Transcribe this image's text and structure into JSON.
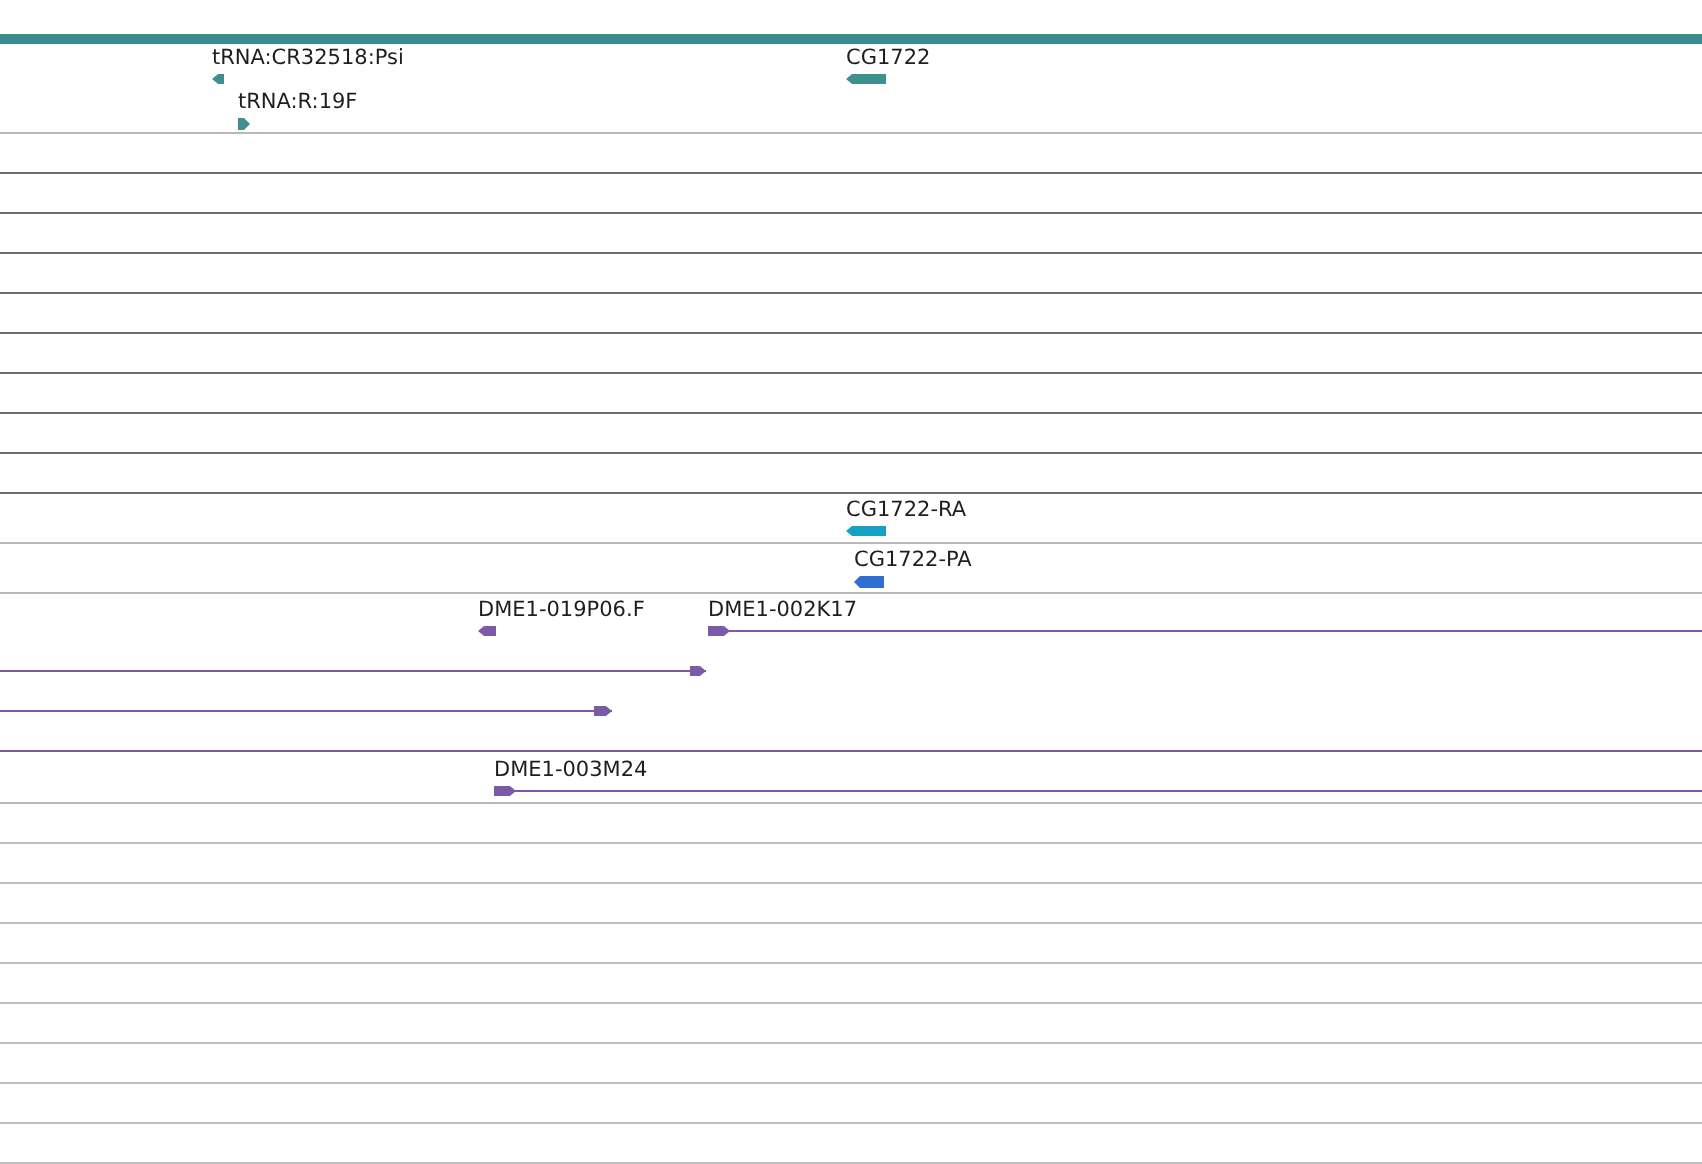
{
  "tracks": [
    {
      "kind": "gene",
      "lanes": [
        {
          "features": [
            {
              "kind": "arrow",
              "label": "tRNA:CR32518:Psi",
              "reverse": true,
              "color": "#3f8f91"
            },
            {
              "kind": "arrow",
              "label": "CG1722",
              "reverse": true,
              "color": "#3f8f91"
            }
          ]
        },
        {
          "features": [
            {
              "kind": "arrow",
              "label": "tRNA:R:19F",
              "reverse": false,
              "color": "#3f8f91"
            }
          ]
        }
      ]
    },
    {
      "kind": "spacer"
    },
    {
      "kind": "spacer"
    },
    {
      "kind": "spacer"
    },
    {
      "kind": "spacer"
    },
    {
      "kind": "spacer"
    },
    {
      "kind": "spacer"
    },
    {
      "kind": "spacer"
    },
    {
      "kind": "spacer"
    },
    {
      "kind": "spacer"
    },
    {
      "kind": "transcript",
      "lanes": [
        {
          "features": [
            {
              "kind": "arrow",
              "label": "CG1722-RA",
              "reverse": true,
              "color": "#17a0c4"
            }
          ]
        }
      ]
    },
    {
      "kind": "transcript",
      "lanes": [
        {
          "features": [
            {
              "kind": "arrow",
              "label": "CG1722-PA",
              "reverse": true,
              "color": "#2f6fd2"
            }
          ]
        }
      ]
    },
    {
      "kind": "clone",
      "lanes": [
        {
          "features": [
            {
              "kind": "arrow",
              "label": "DME1-019P06.F",
              "reverse": true,
              "color": "#7b5ba8"
            },
            {
              "kind": "arrow",
              "label": "DME1-002K17",
              "reverse": false,
              "color": "#7b5ba8"
            }
          ]
        },
        {
          "features": [
            {
              "kind": "arrow",
              "reverse": false,
              "color": "#7b5ba8"
            }
          ]
        },
        {
          "features": [
            {
              "kind": "arrow",
              "reverse": false,
              "color": "#7b5ba8"
            }
          ]
        },
        {
          "features": [
            {
              "kind": "span",
              "color": "#7b5ba8"
            }
          ]
        },
        {
          "features": [
            {
              "kind": "arrow",
              "label": "DME1-003M24",
              "reverse": false,
              "color": "#7b5ba8"
            }
          ]
        }
      ]
    },
    {
      "kind": "empty"
    },
    {
      "kind": "empty"
    },
    {
      "kind": "empty"
    },
    {
      "kind": "empty"
    },
    {
      "kind": "empty"
    },
    {
      "kind": "empty"
    },
    {
      "kind": "empty"
    },
    {
      "kind": "empty"
    },
    {
      "kind": "empty"
    }
  ]
}
